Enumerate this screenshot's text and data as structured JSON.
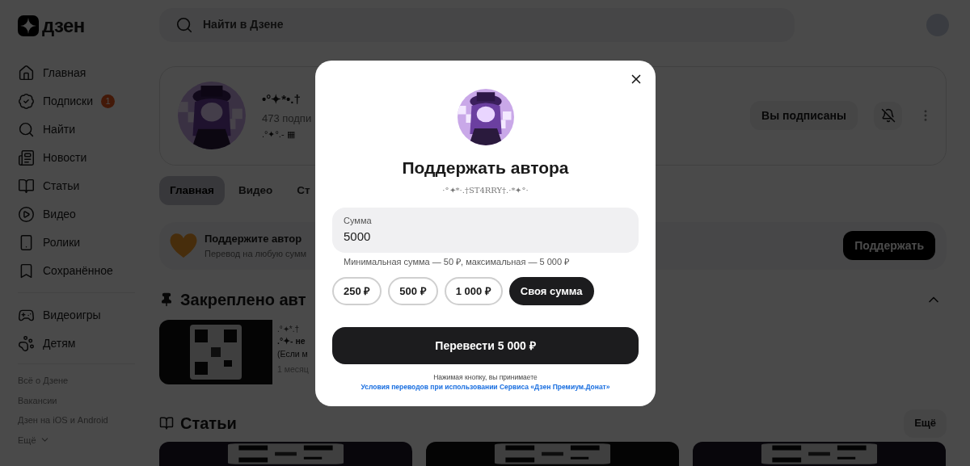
{
  "header": {
    "logo": "дзен",
    "search": {
      "placeholder": "Найти в Дзене"
    }
  },
  "sidebar": {
    "items": [
      {
        "label": "Главная"
      },
      {
        "label": "Подписки",
        "badge": "1"
      },
      {
        "label": "Найти"
      },
      {
        "label": "Новости"
      },
      {
        "label": "Статьи"
      },
      {
        "label": "Видео"
      },
      {
        "label": "Ролики"
      },
      {
        "label": "Сохранённое"
      }
    ],
    "extra_items": [
      {
        "label": "Видеоигры"
      },
      {
        "label": "Детям"
      }
    ],
    "footer_links": [
      "Всё о Дзене",
      "Вакансии",
      "Дзен на iOS и Android"
    ],
    "more": "Ещё"
  },
  "channel": {
    "name": "•°✦*•.†",
    "subscribers": "473 подпи",
    "description": ".°✦°.- ▦",
    "subscribe_button": "Вы подписаны"
  },
  "tabs": [
    {
      "label": "Главная",
      "selected": true
    },
    {
      "label": "Видео",
      "selected": false
    },
    {
      "label": "Ст",
      "selected": false
    }
  ],
  "support_banner": {
    "title": "Поддержите автор",
    "subtitle": "Перевод на любую сумм",
    "button": "Поддержать"
  },
  "pinned": {
    "heading": "Закреплено авт",
    "card": {
      "author": ".°✦*.†",
      "title": ".°✦- не",
      "snippet": "(Если м",
      "date": "1 месяц"
    }
  },
  "articles": {
    "heading": "Статьи",
    "more_button": "Ещё"
  },
  "modal": {
    "title": "Поддержать автора",
    "author": "·°✦*·.†ST4RRY†.·*✦°·",
    "amount": {
      "label": "Сумма",
      "value": "5000"
    },
    "hint": "Минимальная сумма — 50 ₽, максимальная — 5 000 ₽",
    "presets": [
      {
        "label": "250 ₽",
        "selected": false
      },
      {
        "label": "500 ₽",
        "selected": false
      },
      {
        "label": "1 000 ₽",
        "selected": false
      },
      {
        "label": "Своя сумма",
        "selected": true
      }
    ],
    "submit": "Перевести 5 000 ₽",
    "terms": "Нажимая кнопку, вы принимаете",
    "terms_link": "Условия переводов при использовании Сервиса «Дзен Премиум.Донат»"
  }
}
